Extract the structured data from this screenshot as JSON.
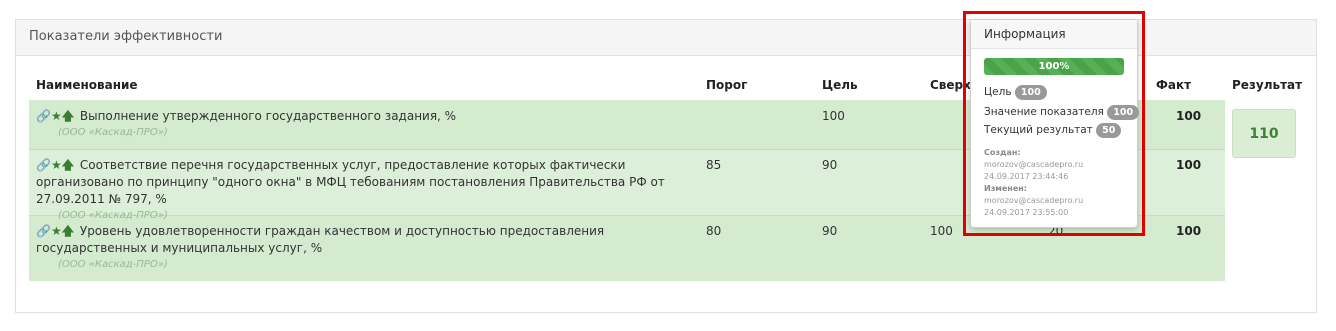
{
  "panel": {
    "title": "Показатели эффективности"
  },
  "table": {
    "headers": {
      "name": "Наименование",
      "threshold": "Порог",
      "target": "Цель",
      "over": "Сверх",
      "fact": "Факт",
      "result": "Результат"
    },
    "rows": [
      {
        "icons": "🔗★🡅",
        "name": "Выполнение утвержденного государственного задания, %",
        "org": "(ООО «Каскад-ПРО»)",
        "threshold": "",
        "target": "100",
        "over": "",
        "hidden": "",
        "fact": "100"
      },
      {
        "icons": "🔗★🡅",
        "name": "Соответствие перечня государственных услуг, предоставление которых фактически организовано по принципу \"одного окна\" в МФЦ тебованиям постановления Правительства РФ от 27.09.2011 № 797, %",
        "org": "(ООО «Каскад-ПРО»)",
        "threshold": "85",
        "target": "90",
        "over": "",
        "hidden": "",
        "fact": "100"
      },
      {
        "icons": "🔗★🡅",
        "name": "Уровень удовлетворенности граждан качеством и доступностью предоставления государственных и муниципальных услуг, %",
        "org": "(ООО «Каскад-ПРО»)",
        "threshold": "80",
        "target": "90",
        "over": "100",
        "hidden": "20",
        "fact": "100"
      }
    ],
    "result_value": "110"
  },
  "popover": {
    "title": "Информация",
    "progress_percent": 100,
    "progress_label": "100%",
    "goal_label": "Цель",
    "goal_value": "100",
    "indicator_label": "Значение показателя",
    "indicator_value": "100",
    "current_label": "Текущий результат",
    "current_value": "50",
    "created_label": "Создан:",
    "created_by": "morozov@cascadepro.ru",
    "created_at": "24.09.2017 23:44:46",
    "modified_label": "Изменен:",
    "modified_by": "morozov@cascadepro.ru",
    "modified_at": "24.09.2017 23:55:00"
  },
  "colors": {
    "row_green": "#d4ebd0",
    "accent_green": "#3b7d32",
    "progress_green": "#56b054",
    "highlight_red": "#e00000"
  }
}
